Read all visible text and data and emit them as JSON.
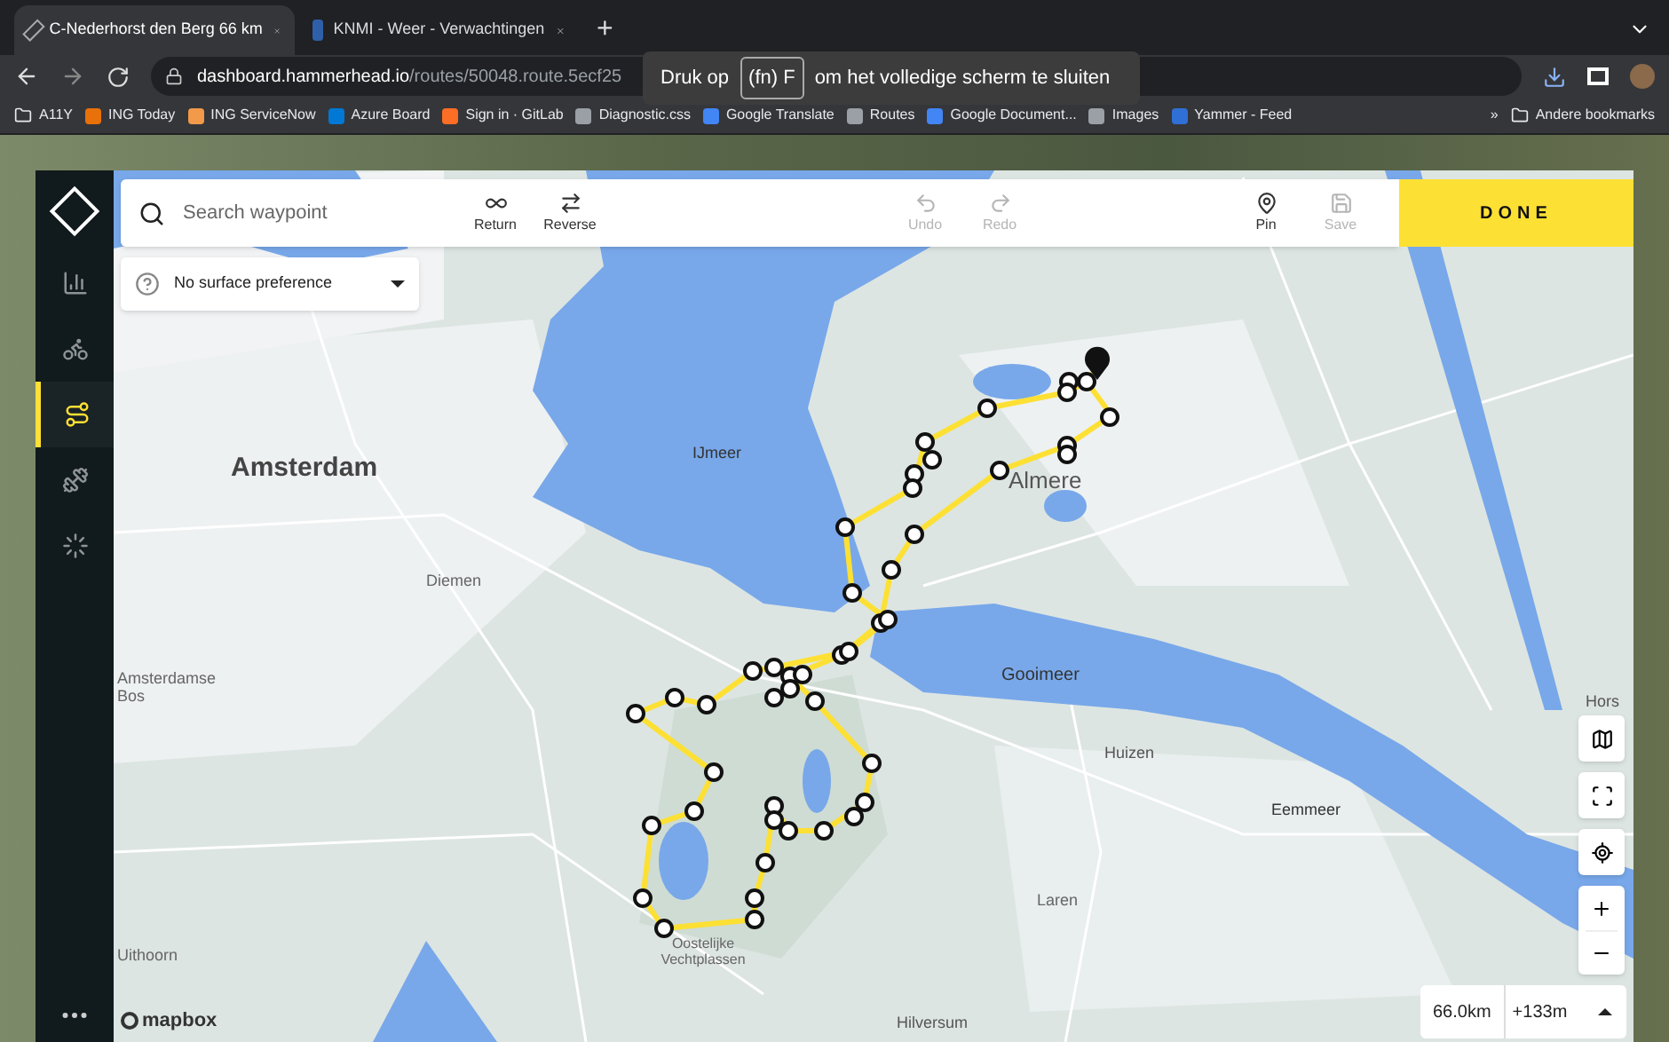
{
  "browser": {
    "tabs": [
      {
        "title": "C-Nederhorst den Berg 66 km",
        "selected": true
      },
      {
        "title": "KNMI - Weer - Verwachtingen",
        "selected": false
      }
    ],
    "new_tab": "+",
    "address": {
      "domain": "dashboard.hammerhead.io",
      "path": "/routes/50048.route.5ecf25"
    },
    "toast": {
      "before": "Druk op",
      "key": "(fn) F",
      "after": "om het volledige scherm te sluiten"
    },
    "bookmarks": [
      "A11Y",
      "ING Today",
      "ING ServiceNow",
      "Azure Board",
      "Sign in · GitLab",
      "Diagnostic.css",
      "Google Translate",
      "Routes",
      "Google Document...",
      "Images",
      "Yammer - Feed"
    ],
    "more_bookmarks": "»",
    "other_bookmarks": "Andere bookmarks"
  },
  "app": {
    "sidebar": {
      "items": [
        {
          "selected": false
        },
        {
          "selected": false
        },
        {
          "selected": true
        },
        {
          "selected": false
        },
        {
          "selected": false
        }
      ]
    },
    "search": {
      "placeholder": "Search waypoint"
    },
    "tools": [
      {
        "label": "Return",
        "disabled": false
      },
      {
        "label": "Reverse",
        "disabled": false
      },
      {
        "label": "Undo",
        "disabled": true
      },
      {
        "label": "Redo",
        "disabled": true
      },
      {
        "label": "Pin",
        "disabled": false
      },
      {
        "label": "Save",
        "disabled": true
      }
    ],
    "done": "DONE",
    "surface": {
      "value": "No surface preference"
    },
    "map": {
      "labels": [
        "Amsterdam",
        "IJmeer",
        "Almere",
        "Diemen",
        "Amsterdamse Bos",
        "Gooimeer",
        "Huizen",
        "Eemmeer",
        "Laren",
        "Uithoorn",
        "Oostelijke Vechtplassen",
        "Hilversum",
        "Hors"
      ],
      "attribution": "mapbox"
    },
    "stats": {
      "distance": "66.0km",
      "elevation": "+133m"
    }
  }
}
